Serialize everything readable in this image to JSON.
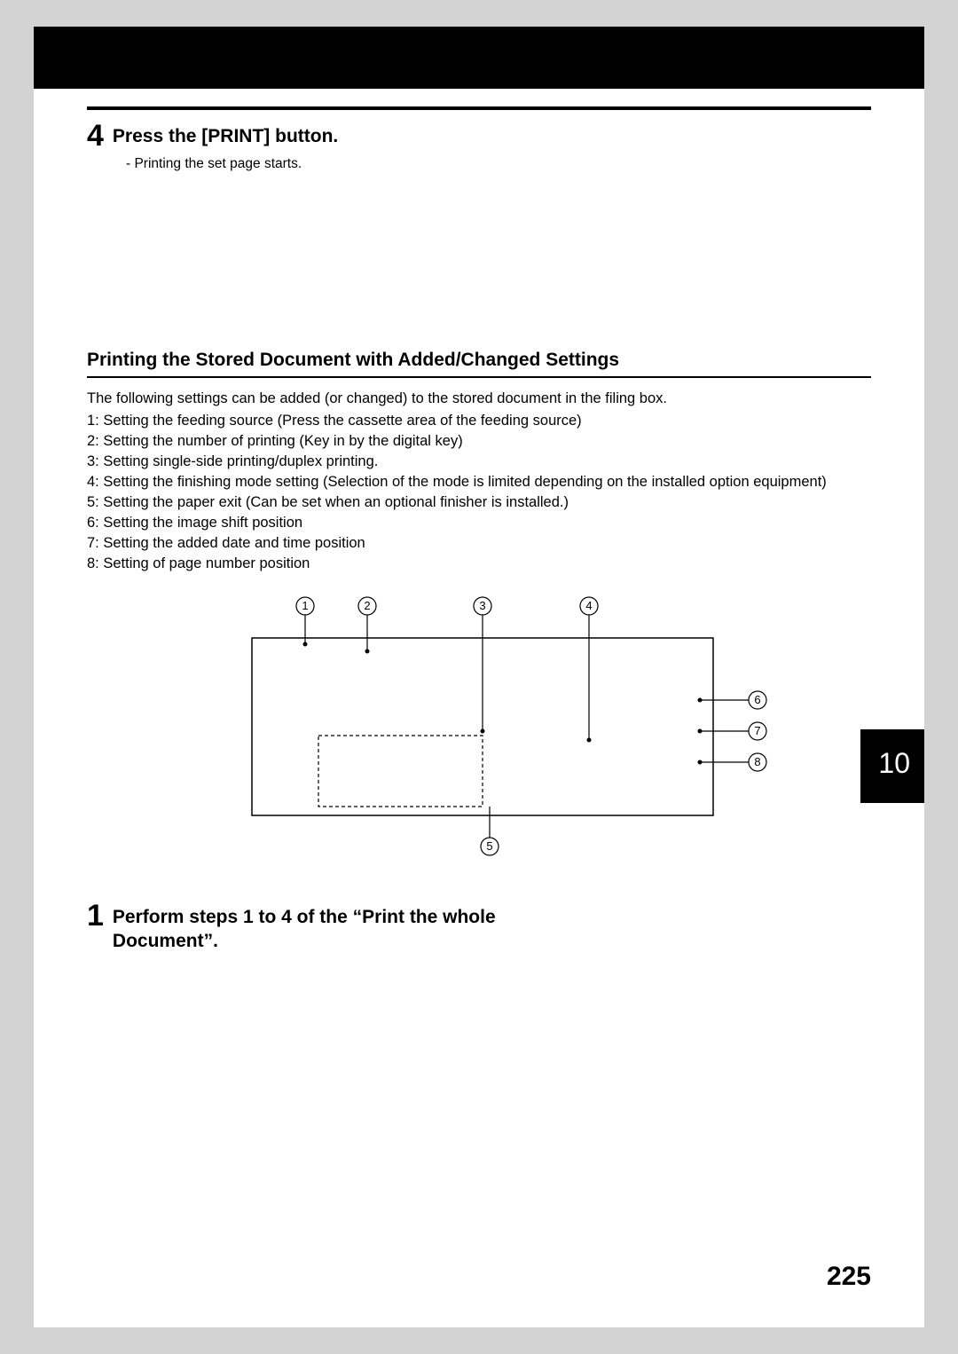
{
  "step4": {
    "number": "4",
    "title": "Press the [PRINT] button.",
    "sub": "-   Printing the set page starts."
  },
  "section": {
    "heading": "Printing the Stored Document with Added/Changed Settings",
    "intro": "The following settings can be added (or changed) to the stored document in the filing box.",
    "items": [
      "1: Setting the feeding source (Press the cassette area of the feeding source)",
      "2: Setting the number of printing (Key in by the digital key)",
      "3: Setting single-side printing/duplex printing.",
      "4: Setting the finishing mode setting (Selection of the mode is limited depending on the installed option equipment)",
      "5: Setting the paper exit (Can be set when an optional finisher is installed.)",
      "6: Setting the image shift position",
      "7: Setting the added date and time position",
      "8: Setting of page number position"
    ]
  },
  "diagram": {
    "labels": [
      "1",
      "2",
      "3",
      "4",
      "5",
      "6",
      "7",
      "8"
    ]
  },
  "step1b": {
    "number": "1",
    "title": "Perform steps 1 to 4 of the “Print the whole Document”."
  },
  "chapterTab": "10",
  "pageNumber": "225"
}
